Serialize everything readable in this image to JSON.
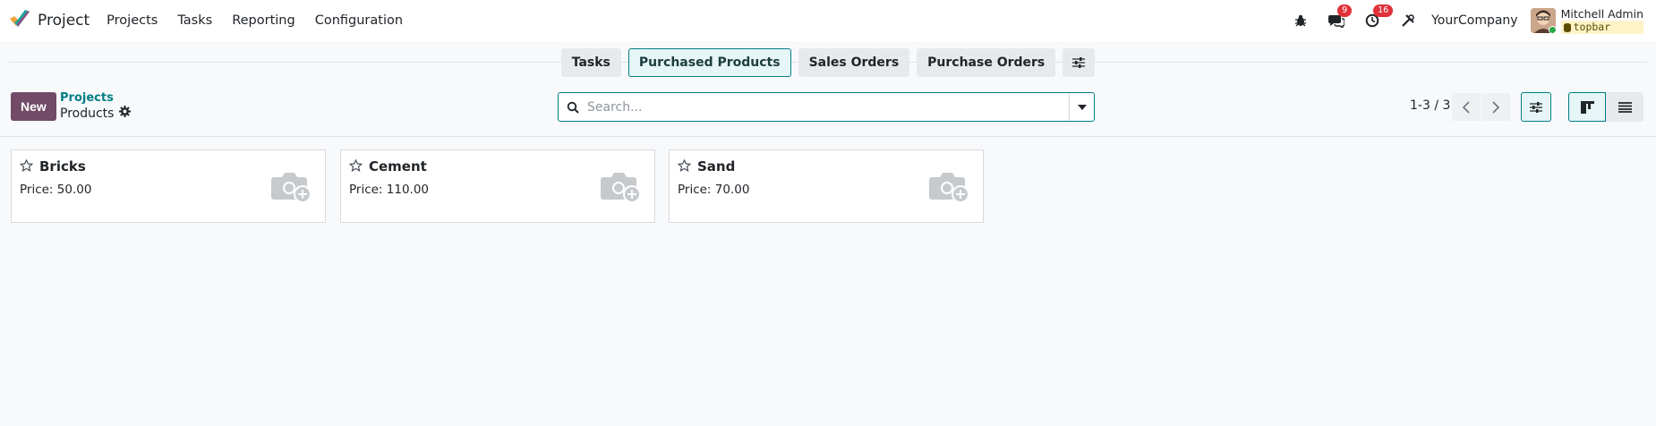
{
  "app": {
    "title": "Project"
  },
  "menu": [
    "Projects",
    "Tasks",
    "Reporting",
    "Configuration"
  ],
  "systray": {
    "messages_count": "9",
    "activities_count": "16",
    "company": "YourCompany",
    "user_name": "Mitchell Admin",
    "db_name": "topbar"
  },
  "actions": [
    {
      "label": "Tasks",
      "active": false
    },
    {
      "label": "Purchased Products",
      "active": true
    },
    {
      "label": "Sales Orders",
      "active": false
    },
    {
      "label": "Purchase Orders",
      "active": false
    }
  ],
  "control": {
    "new_label": "New",
    "breadcrumb_parent": "Projects",
    "breadcrumb_current": "Products",
    "search_placeholder": "Search...",
    "pager": "1-3 / 3"
  },
  "cards": [
    {
      "name": "Bricks",
      "price": "Price: 50.00"
    },
    {
      "name": "Cement",
      "price": "Price: 110.00"
    },
    {
      "name": "Sand",
      "price": "Price: 70.00"
    }
  ],
  "colors": {
    "brand": "#714b67",
    "accent": "#017e84",
    "badge": "#e0313a"
  }
}
